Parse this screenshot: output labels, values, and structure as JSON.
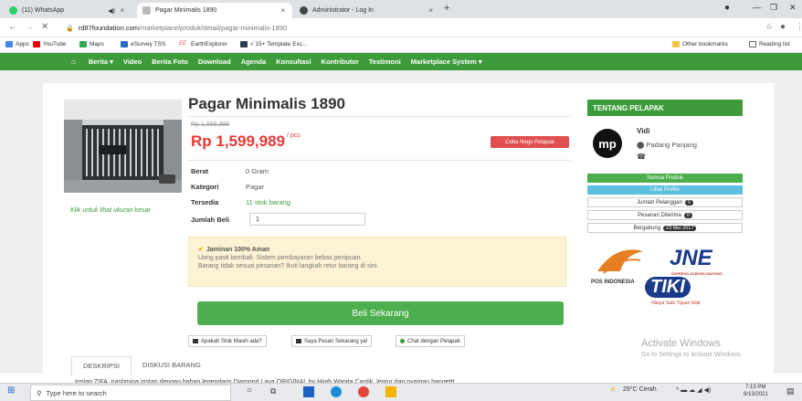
{
  "browser": {
    "tabs": [
      {
        "title": "(11) WhatsApp",
        "active": false,
        "color": "#25d366"
      },
      {
        "title": "Pagar Minimalis 1890",
        "active": true,
        "color": "#888888"
      },
      {
        "title": "Administrator - Log In",
        "active": false,
        "color": "#444444"
      }
    ],
    "url_host": "rd87foundation.com",
    "url_path": "/marketplace/produk/detail/pagar-minimalis-1890",
    "bookmarks": [
      "Apps",
      "YouTube",
      "Maps",
      "eSurvey TSS",
      "EarthExplorer",
      "√ 15+ Template Exc..."
    ],
    "bookmarks_right": [
      "Other bookmarks",
      "Reading list"
    ]
  },
  "site_nav": [
    "Berita ▾",
    "Video",
    "Berita Foto",
    "Download",
    "Agenda",
    "Konsultasi",
    "Kontributor",
    "Testimoni",
    "Marketplace System ▾"
  ],
  "product": {
    "title": "Pagar Minimalis 1890",
    "old_price": "Rp 1,899,999",
    "price": "Rp 1,599,989",
    "unit": "/ pcs",
    "nego_label": "Coba Nego Pelapak",
    "specs": [
      {
        "key": "Berat",
        "value": "0 Gram"
      },
      {
        "key": "Kategori",
        "value": "Pagar"
      },
      {
        "key": "Tersedia",
        "value": "11 stok barang"
      },
      {
        "key": "Jumlah Beli",
        "value": ""
      }
    ],
    "qty": "1",
    "image_caption": "Klik untuk lihat ukuran besar",
    "guarantee_title": "Jaminan 100% Aman",
    "guarantee_lines": [
      "Uang pasti kembali. Sistem pembayaran bebas penipuan.",
      "Barang tidak sesuai pesanan? Ikuti langkah retur barang di sini."
    ],
    "buy_label": "Beli Sekarang",
    "actions": [
      "Apakah Stok Masih ada?",
      "Saya Pesan Sekarang ya!",
      "Chat dengan Pelapak"
    ],
    "tabs": [
      "DESKRIPSI",
      "DISKUSI BARANG"
    ],
    "description": "Instan ZIFA, pashmina instan dengan bahan legendaris Diamond Lava ORIGINAL by Hijab Wanita Cantik, lentur dan nyaman bangettt"
  },
  "seller": {
    "header": "TENTANG PELAPAK",
    "avatar": "mp",
    "name": "Vidi",
    "location": "Padang Panjang",
    "phone_icon": "☎",
    "all_products": "Semua Produk",
    "profile": "Lihat Profile",
    "stats": [
      {
        "label": "Jumlah Pelanggan",
        "badge": "0"
      },
      {
        "label": "Pesanan Diterima",
        "badge": "0"
      },
      {
        "label": "Bergabung",
        "badge": "23 Mei 2017"
      }
    ],
    "pos_label": "POS INDONESIA",
    "jne_label": "JNE",
    "jne_sub": "EXPRESS ACROSS NATIONS",
    "tiki_label": "TIKI",
    "tiki_sub": "Hanya Satu Tujuan Kilat"
  },
  "watermark": {
    "title": "Activate Windows",
    "sub": "Go to Settings to activate Windows."
  },
  "taskbar": {
    "search_placeholder": "Type here to search",
    "weather": "29°C Cerah",
    "time": "7:13 PM",
    "date": "8/13/2021"
  }
}
